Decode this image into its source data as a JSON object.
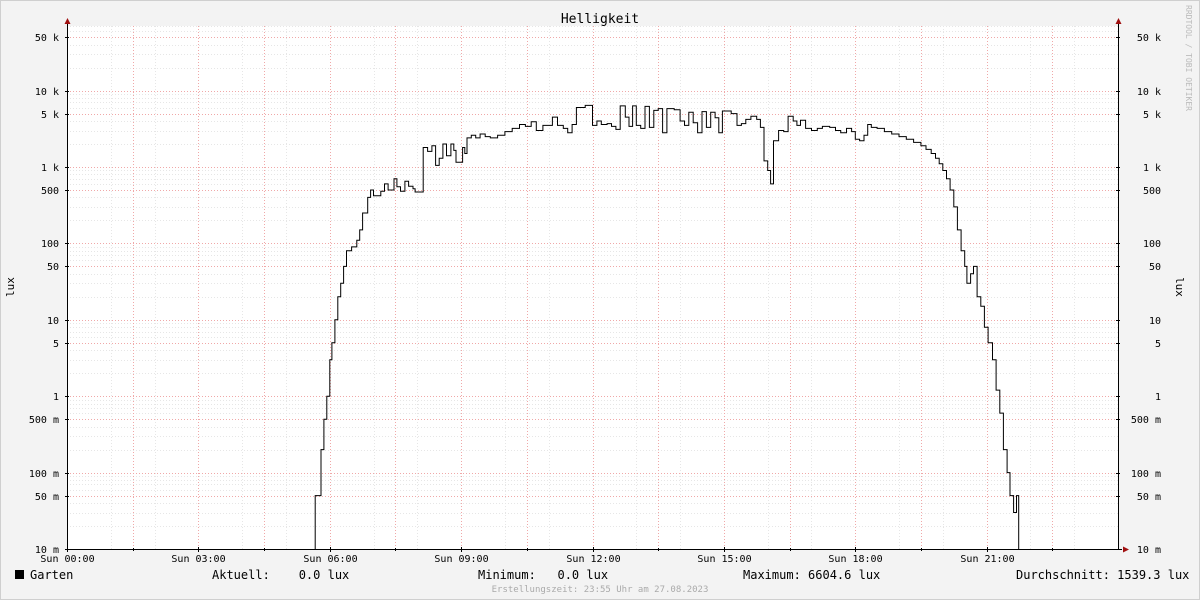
{
  "chart_data": {
    "type": "line",
    "title": "Helligkeit",
    "ylabel_left": "lux",
    "ylabel_right": "lux",
    "credit": "RRDTOOL / TOBI OETIKER",
    "y_scale": "log",
    "ylim": [
      0.01,
      70000
    ],
    "xlim": [
      "00:00",
      "24:00"
    ],
    "y_ticks": [
      {
        "value": 50000,
        "label": "50 k"
      },
      {
        "value": 10000,
        "label": "10 k"
      },
      {
        "value": 5000,
        "label": "5 k"
      },
      {
        "value": 1000,
        "label": "1 k"
      },
      {
        "value": 500,
        "label": "500"
      },
      {
        "value": 100,
        "label": "100"
      },
      {
        "value": 50,
        "label": "50"
      },
      {
        "value": 10,
        "label": "10"
      },
      {
        "value": 5,
        "label": "5"
      },
      {
        "value": 1,
        "label": "1"
      },
      {
        "value": 0.5,
        "label": "500 m"
      },
      {
        "value": 0.1,
        "label": "100 m"
      },
      {
        "value": 0.05,
        "label": "50 m"
      },
      {
        "value": 0.01,
        "label": "10 m"
      }
    ],
    "x_ticks": [
      {
        "hour": 0,
        "label": "Sun 00:00"
      },
      {
        "hour": 3,
        "label": "Sun 03:00"
      },
      {
        "hour": 6,
        "label": "Sun 06:00"
      },
      {
        "hour": 9,
        "label": "Sun 09:00"
      },
      {
        "hour": 12,
        "label": "Sun 12:00"
      },
      {
        "hour": 15,
        "label": "Sun 15:00"
      },
      {
        "hour": 18,
        "label": "Sun 18:00"
      },
      {
        "hour": 21,
        "label": "Sun 21:00"
      }
    ],
    "grid": true,
    "series": [
      {
        "name": "Garten",
        "color": "#000000",
        "points": [
          [
            "05:40",
            0.01
          ],
          [
            "05:40",
            0.05
          ],
          [
            "05:48",
            0.2
          ],
          [
            "05:52",
            0.5
          ],
          [
            "05:56",
            1
          ],
          [
            "06:00",
            3
          ],
          [
            "06:03",
            5
          ],
          [
            "06:07",
            10
          ],
          [
            "06:11",
            20
          ],
          [
            "06:15",
            30
          ],
          [
            "06:19",
            50
          ],
          [
            "06:23",
            80
          ],
          [
            "06:30",
            90
          ],
          [
            "06:37",
            110
          ],
          [
            "06:41",
            150
          ],
          [
            "06:45",
            250
          ],
          [
            "06:52",
            400
          ],
          [
            "06:56",
            500
          ],
          [
            "07:00",
            420
          ],
          [
            "07:10",
            480
          ],
          [
            "07:15",
            600
          ],
          [
            "07:20",
            500
          ],
          [
            "07:28",
            700
          ],
          [
            "07:32",
            550
          ],
          [
            "07:37",
            480
          ],
          [
            "07:43",
            650
          ],
          [
            "07:48",
            560
          ],
          [
            "07:54",
            520
          ],
          [
            "07:57",
            470
          ],
          [
            "08:08",
            1800
          ],
          [
            "08:14",
            1600
          ],
          [
            "08:20",
            1900
          ],
          [
            "08:25",
            1050
          ],
          [
            "08:30",
            1300
          ],
          [
            "08:35",
            2000
          ],
          [
            "08:40",
            1400
          ],
          [
            "08:46",
            2000
          ],
          [
            "08:50",
            1650
          ],
          [
            "08:53",
            1150
          ],
          [
            "09:02",
            1800
          ],
          [
            "09:05",
            1500
          ],
          [
            "09:08",
            2400
          ],
          [
            "09:14",
            2600
          ],
          [
            "09:20",
            2400
          ],
          [
            "09:26",
            2700
          ],
          [
            "09:33",
            2500
          ],
          [
            "09:40",
            2400
          ],
          [
            "09:50",
            2600
          ],
          [
            "10:00",
            2900
          ],
          [
            "10:10",
            3200
          ],
          [
            "10:20",
            3600
          ],
          [
            "10:28",
            3400
          ],
          [
            "10:36",
            3900
          ],
          [
            "10:43",
            3000
          ],
          [
            "10:52",
            3500
          ],
          [
            "11:05",
            4500
          ],
          [
            "11:12",
            3500
          ],
          [
            "11:20",
            3200
          ],
          [
            "11:26",
            2800
          ],
          [
            "11:32",
            3600
          ],
          [
            "11:38",
            6000
          ],
          [
            "11:50",
            6400
          ],
          [
            "12:00",
            3500
          ],
          [
            "12:06",
            4000
          ],
          [
            "12:12",
            3600
          ],
          [
            "12:20",
            3700
          ],
          [
            "12:26",
            3400
          ],
          [
            "12:32",
            3100
          ],
          [
            "12:38",
            6300
          ],
          [
            "12:45",
            4500
          ],
          [
            "12:50",
            3400
          ],
          [
            "12:55",
            6300
          ],
          [
            "13:00",
            3500
          ],
          [
            "13:06",
            3200
          ],
          [
            "13:12",
            6200
          ],
          [
            "13:18",
            3300
          ],
          [
            "13:24",
            5500
          ],
          [
            "13:30",
            5800
          ],
          [
            "13:36",
            2800
          ],
          [
            "13:42",
            5800
          ],
          [
            "13:52",
            5600
          ],
          [
            "14:00",
            4000
          ],
          [
            "14:06",
            3500
          ],
          [
            "14:12",
            5200
          ],
          [
            "14:18",
            3800
          ],
          [
            "14:24",
            2800
          ],
          [
            "14:30",
            5300
          ],
          [
            "14:36",
            3300
          ],
          [
            "14:42",
            5200
          ],
          [
            "14:48",
            4400
          ],
          [
            "14:53",
            2800
          ],
          [
            "14:58",
            5400
          ],
          [
            "15:10",
            5000
          ],
          [
            "15:18",
            3500
          ],
          [
            "15:24",
            3700
          ],
          [
            "15:30",
            4200
          ],
          [
            "15:37",
            4600
          ],
          [
            "15:45",
            4200
          ],
          [
            "15:50",
            3300
          ],
          [
            "15:55",
            1200
          ],
          [
            "16:00",
            900
          ],
          [
            "16:04",
            600
          ],
          [
            "16:08",
            2200
          ],
          [
            "16:15",
            3000
          ],
          [
            "16:22",
            2900
          ],
          [
            "16:28",
            4600
          ],
          [
            "16:35",
            4000
          ],
          [
            "16:40",
            3500
          ],
          [
            "16:45",
            4100
          ],
          [
            "16:52",
            3200
          ],
          [
            "17:00",
            3000
          ],
          [
            "17:08",
            3200
          ],
          [
            "17:15",
            3400
          ],
          [
            "17:25",
            3300
          ],
          [
            "17:33",
            3000
          ],
          [
            "17:40",
            2800
          ],
          [
            "17:48",
            3200
          ],
          [
            "17:55",
            2900
          ],
          [
            "18:00",
            2300
          ],
          [
            "18:06",
            2200
          ],
          [
            "18:12",
            2600
          ],
          [
            "18:17",
            3600
          ],
          [
            "18:22",
            3300
          ],
          [
            "18:30",
            3200
          ],
          [
            "18:40",
            2900
          ],
          [
            "18:50",
            2700
          ],
          [
            "19:00",
            2500
          ],
          [
            "19:10",
            2300
          ],
          [
            "19:20",
            2100
          ],
          [
            "19:30",
            1900
          ],
          [
            "19:37",
            1700
          ],
          [
            "19:44",
            1500
          ],
          [
            "19:50",
            1300
          ],
          [
            "19:55",
            1100
          ],
          [
            "20:00",
            900
          ],
          [
            "20:05",
            700
          ],
          [
            "20:10",
            500
          ],
          [
            "20:15",
            300
          ],
          [
            "20:20",
            150
          ],
          [
            "20:25",
            80
          ],
          [
            "20:30",
            50
          ],
          [
            "20:33",
            30
          ],
          [
            "20:38",
            40
          ],
          [
            "20:42",
            50
          ],
          [
            "20:47",
            20
          ],
          [
            "20:52",
            15
          ],
          [
            "20:57",
            8
          ],
          [
            "21:02",
            5
          ],
          [
            "21:08",
            3
          ],
          [
            "21:13",
            1.2
          ],
          [
            "21:18",
            0.6
          ],
          [
            "21:23",
            0.2
          ],
          [
            "21:28",
            0.1
          ],
          [
            "21:32",
            0.05
          ],
          [
            "21:37",
            0.03
          ],
          [
            "21:41",
            0.05
          ],
          [
            "21:44",
            0.01
          ]
        ]
      }
    ],
    "legend": {
      "name": "Garten",
      "stats": [
        {
          "label": "Aktuell:",
          "value": "0.0 lux"
        },
        {
          "label": "Minimum:",
          "value": "0.0 lux"
        },
        {
          "label": "Maximum:",
          "value": "6604.6 lux"
        },
        {
          "label": "Durchschnitt:",
          "value": "1539.3 lux"
        }
      ]
    },
    "footer": "Erstellungszeit: 23:55 Uhr am 27.08.2023"
  }
}
